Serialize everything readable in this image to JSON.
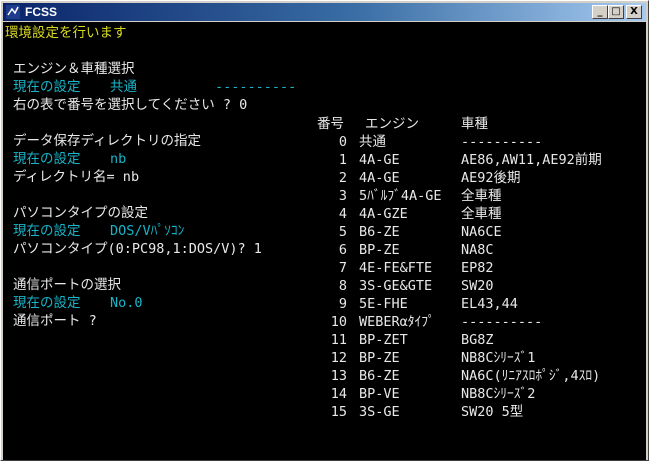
{
  "window": {
    "title": "FCSS",
    "icon": "window-app-icon",
    "buttons": {
      "minimize": "_",
      "maximize": "□",
      "close": "X"
    }
  },
  "console": {
    "header": "環境設定を行います",
    "engine_section": {
      "heading": "エンジン＆車種選択",
      "current_label": "現在の設定",
      "current_value": "共通",
      "current_dashes": "----------",
      "prompt": "右の表で番号を選択してください ? 0"
    },
    "data_dir_section": {
      "heading": "データ保存ディレクトリの指定",
      "current_label": "現在の設定",
      "current_value": "nb",
      "prompt": "ディレクトリ名= nb"
    },
    "pc_type_section": {
      "heading": "パソコンタイプの設定",
      "current_label": "現在の設定",
      "current_value": "DOS/Vﾊﾟｿｺﾝ",
      "prompt": "パソコンタイプ(0:PC98,1:DOS/V)? 1"
    },
    "port_section": {
      "heading": "通信ポートの選択",
      "current_label": "現在の設定",
      "current_value": "No.0",
      "prompt": "通信ポート ?"
    },
    "table": {
      "headers": {
        "number": "番号",
        "engine": "エンジン",
        "vehicle": "車種"
      },
      "rows": [
        {
          "number": "0",
          "engine": "共通",
          "vehicle": "----------"
        },
        {
          "number": "1",
          "engine": "4A-GE",
          "vehicle": "AE86,AW11,AE92前期"
        },
        {
          "number": "2",
          "engine": "4A-GE",
          "vehicle": "AE92後期"
        },
        {
          "number": "3",
          "engine": "5ﾊﾞﾙﾌﾞ4A-GE",
          "vehicle": "全車種"
        },
        {
          "number": "4",
          "engine": "4A-GZE",
          "vehicle": "全車種"
        },
        {
          "number": "5",
          "engine": "B6-ZE",
          "vehicle": "NA6CE"
        },
        {
          "number": "6",
          "engine": "BP-ZE",
          "vehicle": "NA8C"
        },
        {
          "number": "7",
          "engine": "4E-FE&FTE",
          "vehicle": "EP82"
        },
        {
          "number": "8",
          "engine": "3S-GE&GTE",
          "vehicle": "SW20"
        },
        {
          "number": "9",
          "engine": "5E-FHE",
          "vehicle": "EL43,44"
        },
        {
          "number": "10",
          "engine": "WEBERαﾀｲﾌﾟ",
          "vehicle": "----------"
        },
        {
          "number": "11",
          "engine": "BP-ZET",
          "vehicle": "BG8Z"
        },
        {
          "number": "12",
          "engine": "BP-ZE",
          "vehicle": "NB8Cｼﾘｰｽﾞ1"
        },
        {
          "number": "13",
          "engine": "B6-ZE",
          "vehicle": "NA6C(ﾘﾆｱｽﾛﾎﾟｼﾞ,4ｽﾛ)"
        },
        {
          "number": "14",
          "engine": "BP-VE",
          "vehicle": "NB8Cｼﾘｰｽﾞ2"
        },
        {
          "number": "15",
          "engine": "3S-GE",
          "vehicle": "SW20 5型"
        }
      ]
    }
  },
  "colors": {
    "console_bg": "#000000",
    "text": "#e8e8e8",
    "setting": "#18b4c8",
    "header": "#d8d820"
  }
}
